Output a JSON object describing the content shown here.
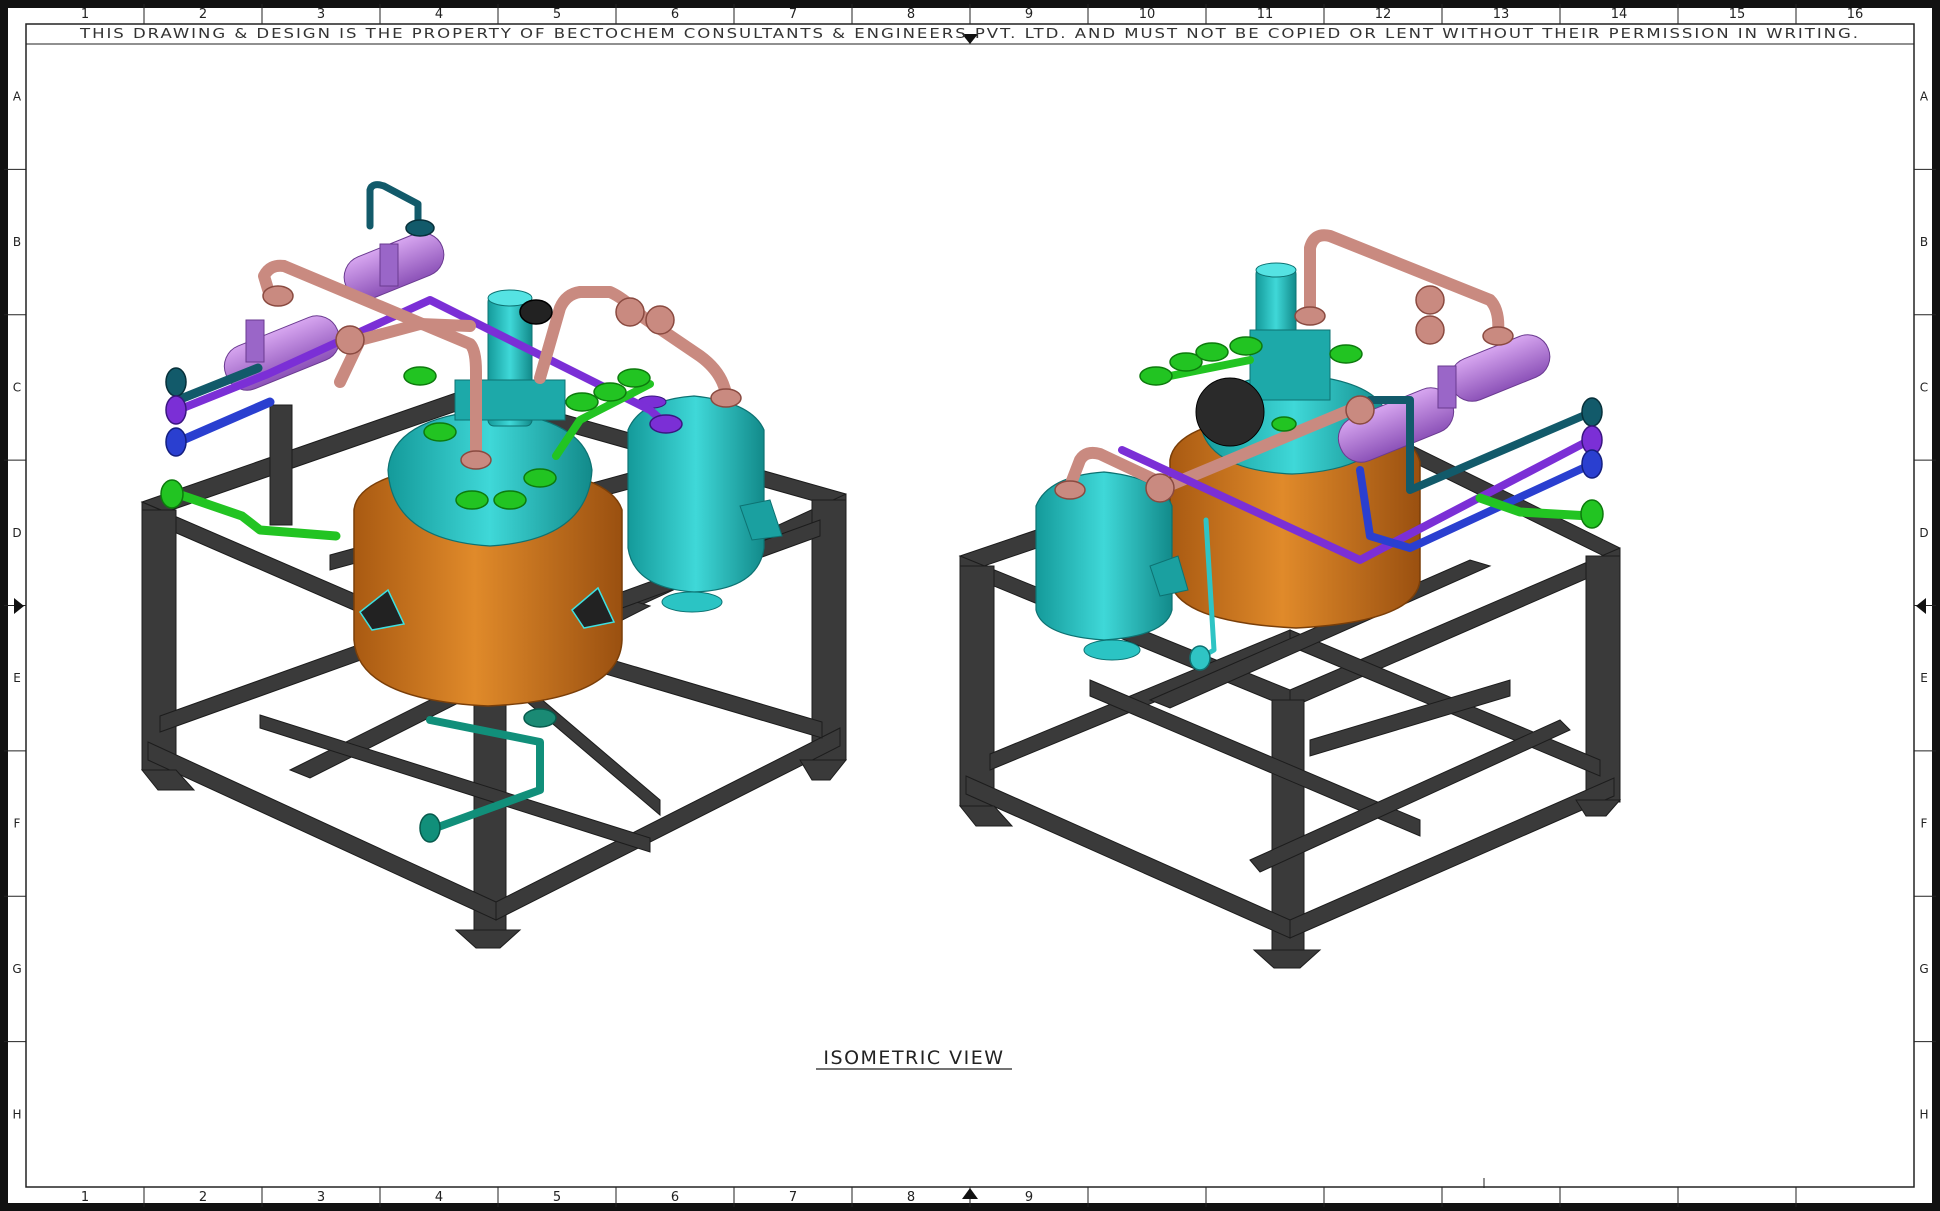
{
  "sheet": {
    "columns": [
      "1",
      "2",
      "3",
      "4",
      "5",
      "6",
      "7",
      "8",
      "9",
      "10",
      "11",
      "12",
      "13",
      "14",
      "15",
      "16"
    ],
    "bottom_columns": [
      "1",
      "2",
      "3",
      "4",
      "5",
      "6",
      "7",
      "8",
      "9"
    ],
    "rows": [
      "A",
      "B",
      "C",
      "D",
      "E",
      "F",
      "G",
      "H"
    ],
    "property_notice": "THIS DRAWING & DESIGN IS THE PROPERTY OF BECTOCHEM CONSULTANTS & ENGINEERS PVT. LTD. AND MUST NOT BE COPIED OR LENT WITHOUT THEIR PERMISSION IN WRITING.",
    "view_label": "ISOMETRIC VIEW"
  },
  "colors": {
    "frame": "#222222",
    "steel": "#3c3c3c",
    "vessel_body": "#c9721e",
    "vessel_head": "#22b5b5",
    "utility_pipe": "#c98a80",
    "jacket_exchanger": "#b57fd6",
    "purple_line": "#7b2fd6",
    "blue_line": "#2a3fd0",
    "dark_teal_line": "#125a6a",
    "green_nozzles": "#22c422"
  }
}
